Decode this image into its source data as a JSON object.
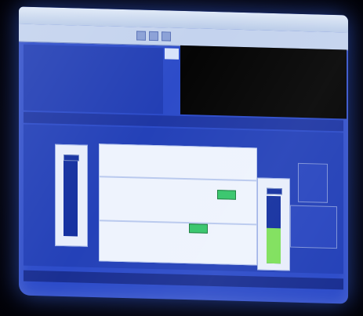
{
  "window": {
    "title": ""
  },
  "info_panel": {
    "rows": [
      {
        "key": "",
        "value": ""
      },
      {
        "key": "",
        "value": ""
      },
      {
        "key": "",
        "value": ""
      },
      {
        "key": "",
        "value": ""
      },
      {
        "key": "",
        "value": ""
      },
      {
        "key": "",
        "value": ""
      }
    ]
  },
  "console": {
    "lines": [
      "",
      "",
      "",
      "",
      "",
      ""
    ]
  },
  "status_strip": {
    "left": "",
    "right": ""
  },
  "diagram": {
    "title": "",
    "markers": [
      "",
      "",
      ""
    ]
  },
  "left_gauge": {
    "labels": ""
  },
  "right_gauge": {
    "level_fraction": 0.52
  },
  "bottom_bar": {
    "text": ""
  },
  "colors": {
    "screen_blue": "#2d4cc9",
    "console_text": "#e8e23a",
    "valve_green": "#35c56a",
    "gauge_fill": "#7fe05c"
  }
}
